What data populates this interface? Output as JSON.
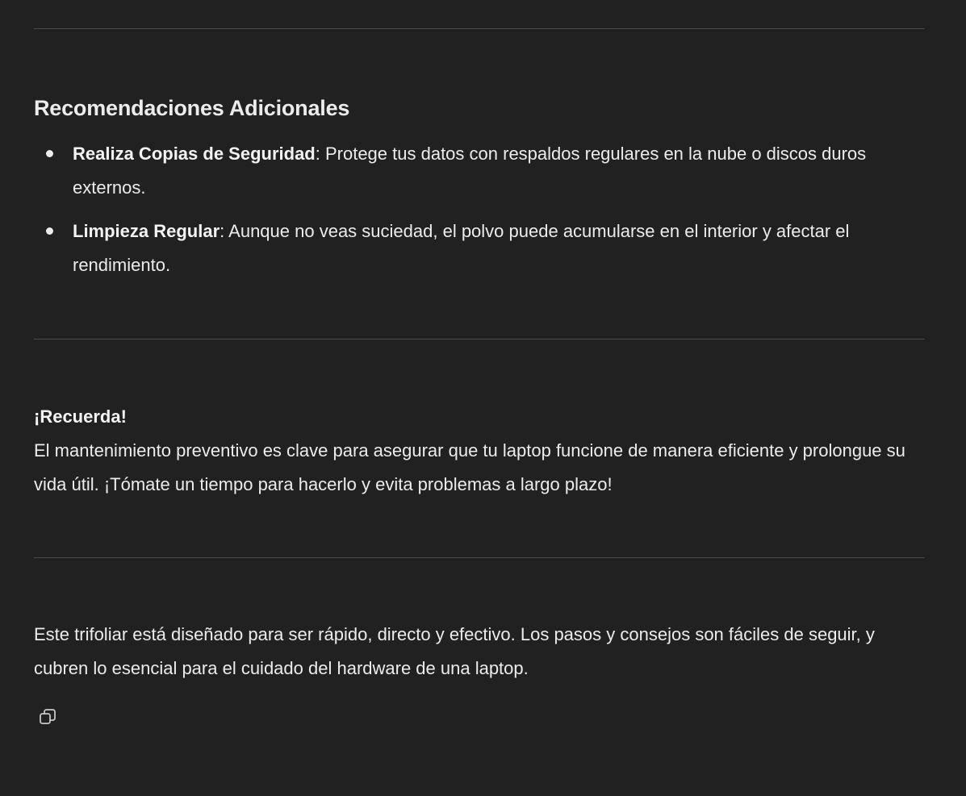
{
  "section": {
    "heading": "Recomendaciones Adicionales",
    "items": [
      {
        "title": "Realiza Copias de Seguridad",
        "text": ": Protege tus datos con respaldos regulares en la nube o discos duros externos."
      },
      {
        "title": "Limpieza Regular",
        "text": ": Aunque no veas suciedad, el polvo puede acumularse en el interior y afectar el rendimiento."
      }
    ]
  },
  "reminder": {
    "title": "¡Recuerda!",
    "text": "El mantenimiento preventivo es clave para asegurar que tu laptop funcione de manera eficiente y prolongue su vida útil. ¡Tómate un tiempo para hacerlo y evita problemas a largo plazo!"
  },
  "closing": {
    "text": "Este trifoliar está diseñado para ser rápido, directo y efectivo. Los pasos y consejos son fáciles de seguir, y cubren lo esencial para el cuidado del hardware de una laptop."
  },
  "actions": {
    "copy_icon": "copy-icon"
  },
  "colors": {
    "background": "#212121",
    "text": "#ececec",
    "divider": "#4a4a4a"
  }
}
